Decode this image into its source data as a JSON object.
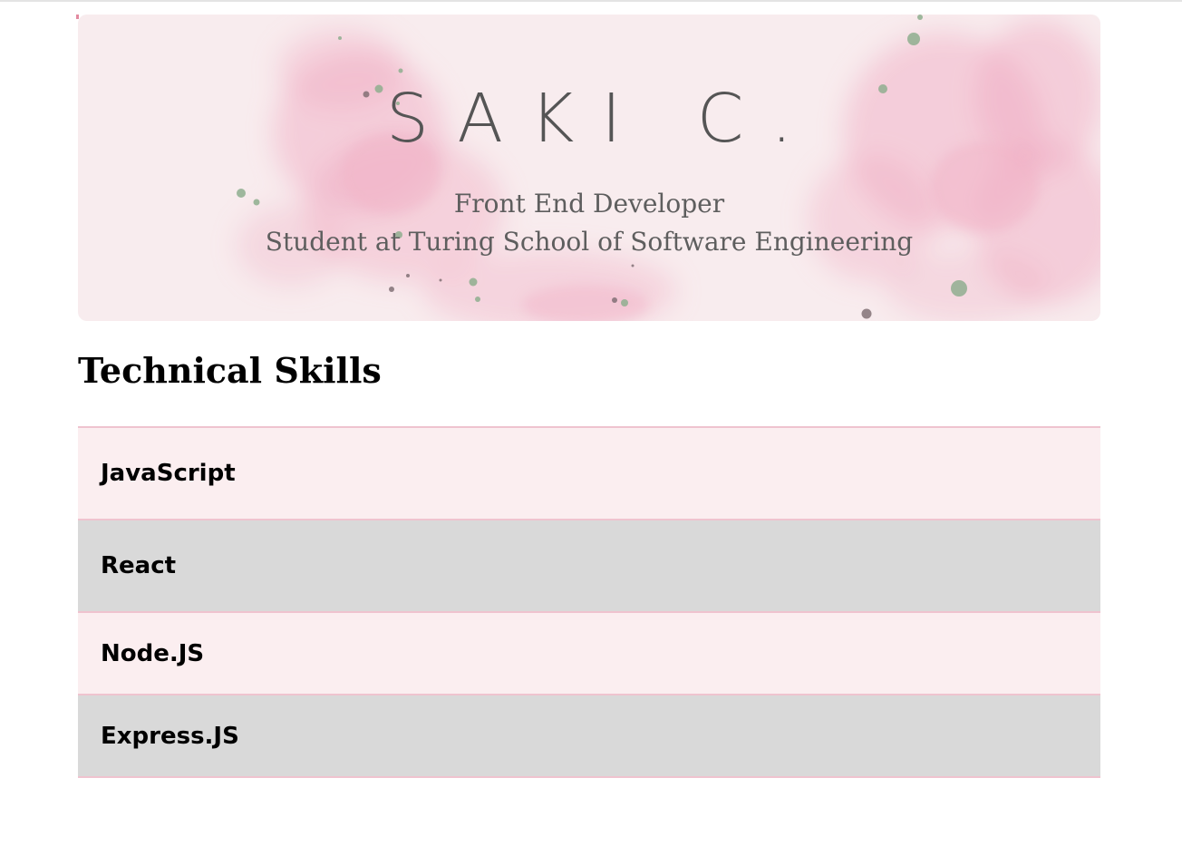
{
  "header": {
    "name": "SAKI C.",
    "role": "Front End Developer",
    "school": "Student at Turing School of Software Engineering"
  },
  "skills_section": {
    "title": "Technical Skills",
    "items": [
      "JavaScript",
      "React",
      "Node.JS",
      "Express.JS"
    ]
  },
  "colors": {
    "banner_background": "#f8ecee",
    "watercolor_pink": "#f0a9c0",
    "splatter_green": "#8fae8f",
    "row_pink": "#fbeef0",
    "row_gray": "#d9d9d9",
    "row_border": "#efc3cf"
  }
}
